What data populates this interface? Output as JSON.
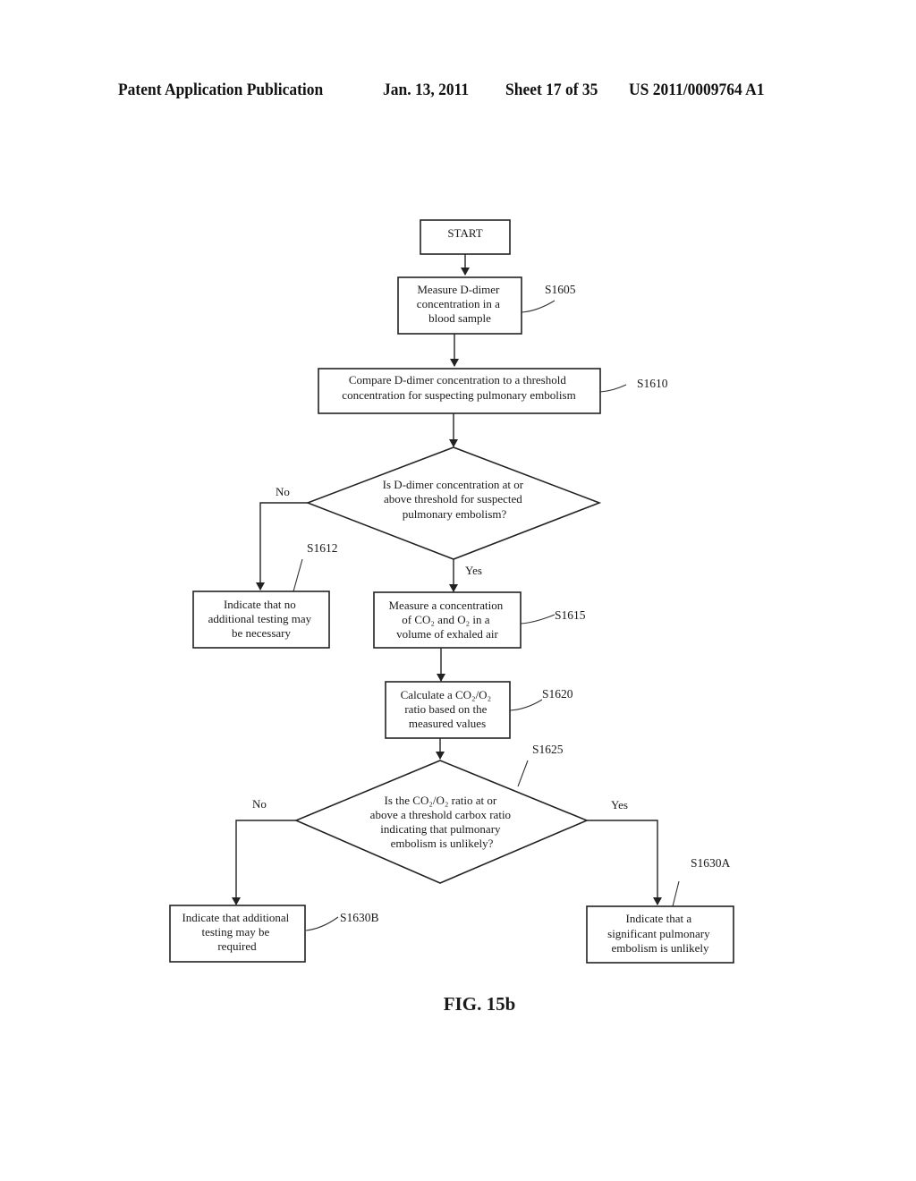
{
  "header": {
    "publication": "Patent Application Publication",
    "date": "Jan. 13, 2011",
    "sheet": "Sheet 17 of 35",
    "number": "US 2011/0009764 A1"
  },
  "flowchart": {
    "start": {
      "lines": [
        "START"
      ]
    },
    "s1605": {
      "ref": "S1605",
      "lines": [
        "Measure D-dimer",
        "concentration in a",
        "blood sample"
      ]
    },
    "s1610": {
      "ref": "S1610",
      "lines": [
        "Compare D-dimer concentration to a threshold",
        "concentration for suspecting pulmonary embolism"
      ]
    },
    "decision1": {
      "lines": [
        "Is D-dimer concentration at or",
        "above threshold for suspected",
        "pulmonary embolism?"
      ],
      "no_label": "No",
      "yes_label": "Yes"
    },
    "s1612": {
      "ref": "S1612",
      "lines": [
        "Indicate that no",
        "additional testing may",
        "be necessary"
      ]
    },
    "s1615": {
      "ref": "S1615",
      "lines": [
        "Measure a concentration",
        "of CO₂ and O₂ in a",
        "volume of exhaled air"
      ]
    },
    "s1620": {
      "ref": "S1620",
      "lines": [
        "Calculate a CO₂/O₂",
        "ratio based on the",
        "measured values"
      ]
    },
    "s1625": {
      "ref": "S1625",
      "lines": [
        "Is the CO₂/O₂ ratio at or",
        "above a threshold carbox ratio",
        "indicating that  pulmonary",
        "embolism is unlikely?"
      ],
      "no_label": "No",
      "yes_label": "Yes"
    },
    "s1630b": {
      "ref": "S1630B",
      "lines": [
        "Indicate that additional",
        "testing may be",
        "required"
      ]
    },
    "s1630a": {
      "ref": "S1630A",
      "lines": [
        "Indicate that a",
        "significant pulmonary",
        "embolism is unlikely"
      ]
    }
  },
  "figure_label": "FIG. 15b"
}
